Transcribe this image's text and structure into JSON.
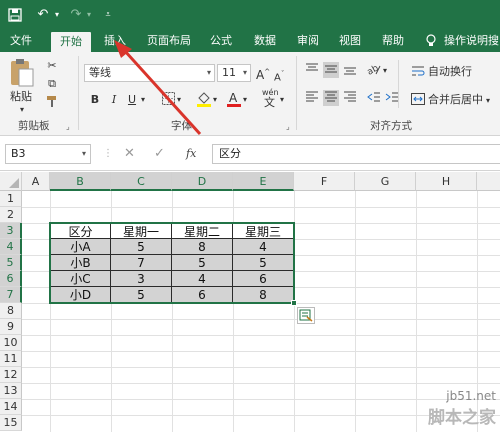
{
  "quick_access": {
    "save_icon": "save-icon",
    "undo_icon": "undo-icon",
    "redo_icon": "redo-icon",
    "customize_icon": "customize-icon"
  },
  "tabs": [
    "文件",
    "开始",
    "插入",
    "页面布局",
    "公式",
    "数据",
    "审阅",
    "视图",
    "帮助"
  ],
  "active_tab": "开始",
  "tell_me": "操作说明搜",
  "ribbon": {
    "clipboard": {
      "paste": "粘贴",
      "group": "剪贴板"
    },
    "font": {
      "font_name": "等线",
      "font_size": "11",
      "bold": "B",
      "italic": "I",
      "underline": "U",
      "group": "字体",
      "grow": "A",
      "shrink": "A",
      "phonetic_top": "wén",
      "phonetic_bottom": "文"
    },
    "alignment": {
      "wrap": "自动换行",
      "merge": "合并后居中",
      "group": "对齐方式"
    }
  },
  "formula_bar": {
    "name_box": "B3",
    "fx": "fx",
    "content": "区分"
  },
  "columns": [
    "A",
    "B",
    "C",
    "D",
    "E",
    "F",
    "G",
    "H"
  ],
  "rows": [
    "1",
    "2",
    "3",
    "4",
    "5",
    "6",
    "7",
    "8",
    "9",
    "10",
    "11",
    "12",
    "13",
    "14",
    "15"
  ],
  "table": {
    "headers": [
      "区分",
      "星期一",
      "星期二",
      "星期三"
    ],
    "rows": [
      [
        "小A",
        "5",
        "8",
        "4"
      ],
      [
        "小B",
        "7",
        "5",
        "5"
      ],
      [
        "小C",
        "3",
        "4",
        "6"
      ],
      [
        "小D",
        "5",
        "6",
        "8"
      ]
    ]
  },
  "watermark": {
    "site": "jb51.net",
    "brand": "脚本之家"
  },
  "colors": {
    "excel_green": "#217346",
    "arrow_red": "#d9342b",
    "selection_gray": "#d3d3d3"
  }
}
